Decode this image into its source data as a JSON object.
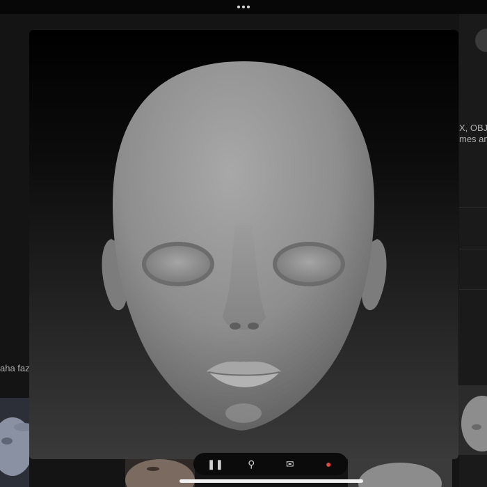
{
  "top_bar": {
    "indicator": "more-dots"
  },
  "background_page": {
    "right_text_line1": "X, OBJ,",
    "right_text_line2": "mes an",
    "left_text": "aha faz"
  },
  "preview": {
    "subject": "3d-sculpted-head"
  },
  "dock": {
    "icons": [
      "pause-icon",
      "search-icon",
      "chat-icon",
      "record-icon"
    ]
  }
}
